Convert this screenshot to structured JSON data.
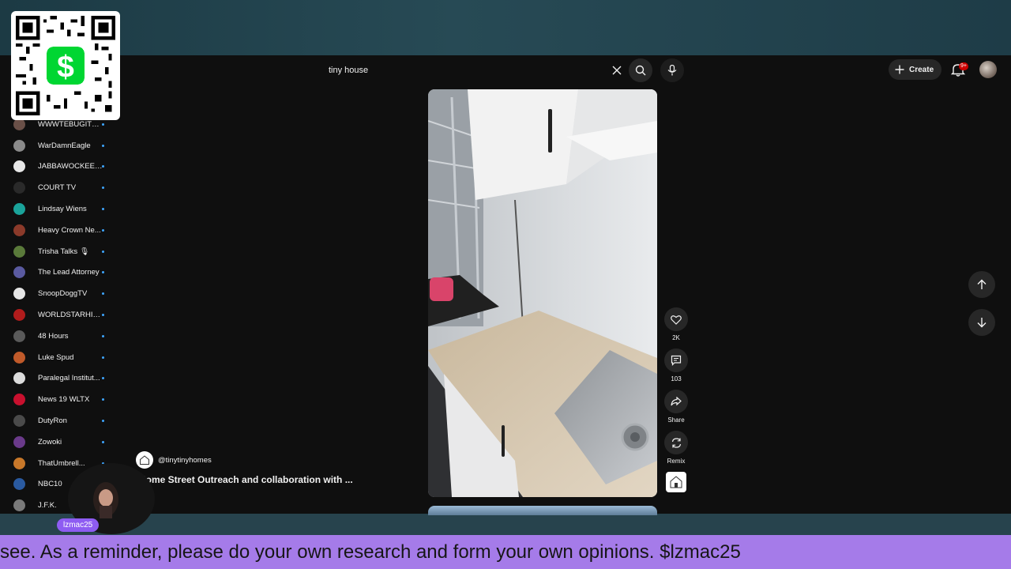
{
  "search": {
    "value": "tiny house"
  },
  "header": {
    "create_label": "Create",
    "notification_badge": "9+"
  },
  "sidebar": {
    "items": [
      {
        "name": "WWWTEBUGITDOL...",
        "color": "#6a5048"
      },
      {
        "name": "WarDamnEagle",
        "color": "#8a8a8a"
      },
      {
        "name": "JABBAWOCKEEZ O...",
        "color": "#e8e8e8"
      },
      {
        "name": "COURT TV",
        "color": "#2a2a2a"
      },
      {
        "name": "Lindsay Wiens",
        "color": "#1aa39a"
      },
      {
        "name": "Heavy Crown Ne...",
        "color": "#8b3a2a"
      },
      {
        "name": "Trisha Talks 🎙",
        "color": "#5a7a3a"
      },
      {
        "name": "The Lead Attorney",
        "color": "#5a5aa0"
      },
      {
        "name": "SnoopDoggTV",
        "color": "#e6e6e6"
      },
      {
        "name": "WORLDSTARHIP...",
        "color": "#b01c1c"
      },
      {
        "name": "48 Hours",
        "color": "#5a5a5a"
      },
      {
        "name": "Luke Spud",
        "color": "#c05a2a"
      },
      {
        "name": "Paralegal Institut...",
        "color": "#dcdcdc"
      },
      {
        "name": "News 19 WLTX",
        "color": "#c8102e"
      },
      {
        "name": "DutyRon",
        "color": "#4a4a4a"
      },
      {
        "name": "Zowoki",
        "color": "#6a3a8a"
      },
      {
        "name": "ThatUmbrell...",
        "color": "#c8782a"
      },
      {
        "name": "NBC10",
        "color": "#2a5aa0"
      },
      {
        "name": "J.F.K.",
        "color": "#7a7a7a"
      }
    ]
  },
  "short": {
    "actions": {
      "like_count": "2K",
      "comment_count": "103",
      "share_label": "Share",
      "remix_label": "Remix"
    },
    "channel_handle": "@tinytinyhomes",
    "title": "Home Street Outreach and collaboration with ..."
  },
  "overlay": {
    "streamer_tag": "lzmac25",
    "ticker": "see. As a reminder, please do your own research and form your own opinions. $lzmac25"
  }
}
